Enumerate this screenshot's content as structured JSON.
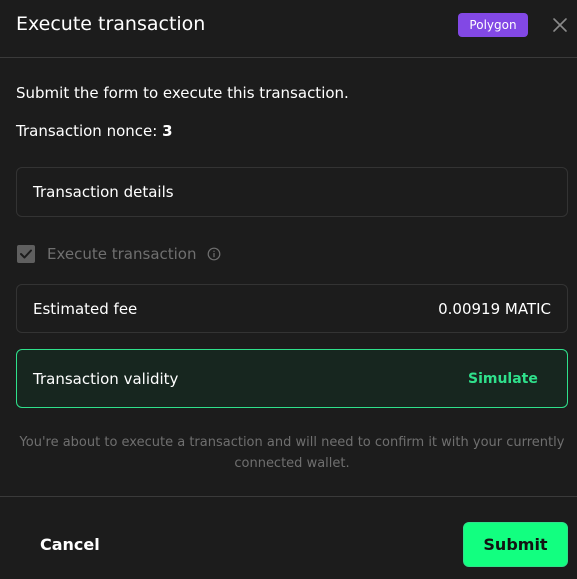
{
  "header": {
    "title": "Execute transaction",
    "chain_badge": "Polygon",
    "chain_color": "#8248e5",
    "close_icon": "close-icon"
  },
  "intro": "Submit the form to execute this transaction.",
  "nonce": {
    "label": "Transaction nonce:",
    "value": "3"
  },
  "details": {
    "label": "Transaction details"
  },
  "execute_checkbox": {
    "label": "Execute transaction",
    "checked": true,
    "info_icon": "info-icon"
  },
  "fee": {
    "label": "Estimated fee",
    "value": "0.00919 MATIC"
  },
  "validity": {
    "label": "Transaction validity",
    "action": "Simulate",
    "accent": "#2fe08b"
  },
  "notice": "You're about to execute a transaction and will need to confirm it with your currently connected wallet.",
  "footer": {
    "cancel_label": "Cancel",
    "submit_label": "Submit",
    "submit_color": "#12ff80"
  }
}
